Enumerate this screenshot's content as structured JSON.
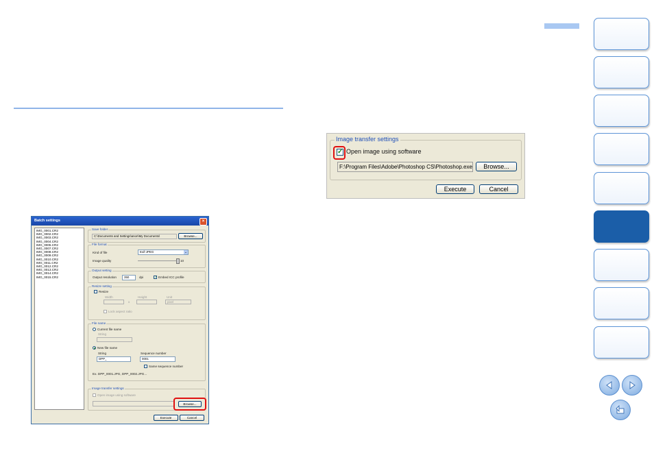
{
  "small_dialog": {
    "title": "Batch settings",
    "close_glyph": "×",
    "files": [
      "IMG_0001.CR2",
      "IMG_0002.CR2",
      "IMG_0003.CR2",
      "IMG_0004.CR2",
      "IMG_0005.CR2",
      "IMG_0007.CR2",
      "IMG_0008.CR2",
      "IMG_0009.CR2",
      "IMG_0010.CR2",
      "IMG_0011.CR2",
      "IMG_0012.CR2",
      "IMG_0013.CR2",
      "IMG_0014.CR2",
      "IMG_0015.CR2"
    ],
    "save_folder": {
      "legend": "Save folder",
      "path": "C:\\Documents and Settings\\anon\\My Documents\\",
      "browse": "Browse..."
    },
    "file_format": {
      "legend": "File format",
      "kind_label": "Kind of file",
      "kind_value": "Exif-JPEG",
      "quality_label": "Image quality",
      "quality_value": "10"
    },
    "output": {
      "legend": "Output setting",
      "resolution_label": "Output resolution",
      "resolution_value": "350",
      "unit": "dpi",
      "icc_label": "Embed ICC profile"
    },
    "resize": {
      "legend": "Resize setting",
      "resize_label": "Resize",
      "width_label": "Width",
      "height_label": "Height",
      "unit_label": "Unit",
      "x": "x",
      "unit_value": "pixel",
      "lock_label": "Lock aspect ratio"
    },
    "file_name": {
      "legend": "File name",
      "current_label": "Current file name",
      "string_label": "String",
      "new_label": "New file name",
      "string2_label": "String",
      "string_value": "DPP_",
      "seq_label": "Sequence number",
      "seq_value": "0001",
      "same_seq_label": "Same sequence number",
      "example": "Ex.   DPP_0001.JPG, DPP_0002.JPG..."
    },
    "transfer": {
      "legend": "Image transfer settings",
      "open_label": "Open image using software",
      "browse": "Browse..."
    },
    "execute": "Execute",
    "cancel": "Cancel"
  },
  "large_crop": {
    "legend": "Image transfer settings",
    "open_label": "Open image using software",
    "path": "F:\\Program Files\\Adobe\\Photoshop CS\\Photoshop.exe",
    "browse": "Browse...",
    "execute": "Execute",
    "cancel": "Cancel",
    "checked_glyph": "✓"
  },
  "colors": {
    "accent_tab": "#1b5ea8",
    "highlight": "#e01010",
    "rule": "#8fb4e8"
  },
  "nav": {
    "prev_icon": "prev-page-icon",
    "next_icon": "next-page-icon",
    "back_icon": "return-icon"
  }
}
